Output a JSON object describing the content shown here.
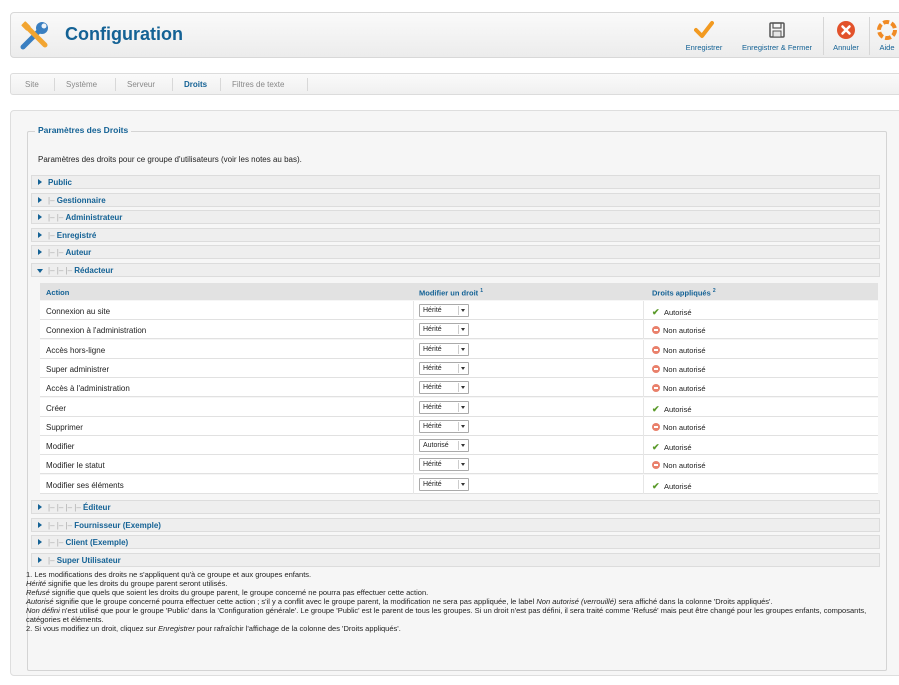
{
  "header": {
    "title": "Configuration",
    "toolbar": {
      "save": "Enregistrer",
      "save_close": "Enregistrer & Fermer",
      "cancel": "Annuler",
      "help": "Aide"
    }
  },
  "submenu": {
    "tabs": [
      "Site",
      "Système",
      "Serveur",
      "Droits",
      "Filtres de texte"
    ],
    "active": "Droits"
  },
  "permissions": {
    "legend": "Paramètres des Droits",
    "description": "Paramètres des droits pour ce groupe d'utilisateurs (voir les notes au bas).",
    "groups_before": [
      {
        "prefix": "",
        "name": "Public"
      },
      {
        "prefix": "|– ",
        "name": "Gestionnaire"
      },
      {
        "prefix": "|– |– ",
        "name": "Administrateur"
      },
      {
        "prefix": "|– ",
        "name": "Enregistré"
      },
      {
        "prefix": "|– |– ",
        "name": "Auteur"
      },
      {
        "prefix": "|– |– |– ",
        "name": "Rédacteur"
      }
    ],
    "columns": {
      "action": "Action",
      "modify": "Modifier un droit",
      "modify_sup": "1",
      "applied": "Droits appliqués",
      "applied_sup": "2"
    },
    "rows": [
      {
        "action": "Connexion au site",
        "setting": "Hérité",
        "applied": "Autorisé",
        "allowed": true
      },
      {
        "action": "Connexion à l'administration",
        "setting": "Hérité",
        "applied": "Non autorisé",
        "allowed": false
      },
      {
        "action": "Accès hors-ligne",
        "setting": "Hérité",
        "applied": "Non autorisé",
        "allowed": false
      },
      {
        "action": "Super administrer",
        "setting": "Hérité",
        "applied": "Non autorisé",
        "allowed": false
      },
      {
        "action": "Accès à l'administration",
        "setting": "Hérité",
        "applied": "Non autorisé",
        "allowed": false
      },
      {
        "action": "Créer",
        "setting": "Hérité",
        "applied": "Autorisé",
        "allowed": true
      },
      {
        "action": "Supprimer",
        "setting": "Hérité",
        "applied": "Non autorisé",
        "allowed": false
      },
      {
        "action": "Modifier",
        "setting": "Autorisé",
        "applied": "Autorisé",
        "allowed": true
      },
      {
        "action": "Modifier le statut",
        "setting": "Hérité",
        "applied": "Non autorisé",
        "allowed": false
      },
      {
        "action": "Modifier ses éléments",
        "setting": "Hérité",
        "applied": "Autorisé",
        "allowed": true
      }
    ],
    "groups_after": [
      {
        "prefix": "|– |– |– |– ",
        "name": "Éditeur"
      },
      {
        "prefix": "|– |– |– ",
        "name": "Fournisseur (Exemple)"
      },
      {
        "prefix": "|– |– ",
        "name": "Client (Exemple)"
      },
      {
        "prefix": "|– ",
        "name": "Super Utilisateur"
      }
    ]
  },
  "notes": {
    "n1": "1. Les modifications des droits ne s'appliquent qu'à ce groupe et aux groupes enfants.",
    "herite_term": "Hérité",
    "herite_text": " signifie que les droits du groupe parent seront utilisés.",
    "refuse_term": "Refusé",
    "refuse_text": " signifie que quels que soient les droits du groupe parent, le groupe concerné ne pourra pas effectuer cette action.",
    "autorise_term": "Autorisé",
    "autorise_text_a": " signifie que le groupe concerné pourra effectuer cette action ; s'il y a conflit avec le groupe parent, la modification ne sera pas appliquée, le label ",
    "autorise_label": "Non autorisé (verrouillé)",
    "autorise_text_b": " sera affiché dans la colonne 'Droits appliqués'.",
    "nondef_term": "Non défini",
    "nondef_text": " n'est utilisé que pour le groupe 'Public' dans la 'Configuration générale'. Le groupe 'Public' est le parent de tous les groupes. Si un droit n'est pas défini, il sera traité comme 'Refusé' mais peut être changé pour les groupes enfants, composants, catégories et éléments.",
    "n2_a": "2. Si vous modifiez un droit, cliquez sur ",
    "n2_term": "Enregistrer",
    "n2_b": " pour rafraîchir l'affichage de la colonne des 'Droits appliqués'."
  },
  "colors": {
    "brand": "#146295",
    "allowed": "#5a9a2a",
    "denied": "#e9806b"
  }
}
